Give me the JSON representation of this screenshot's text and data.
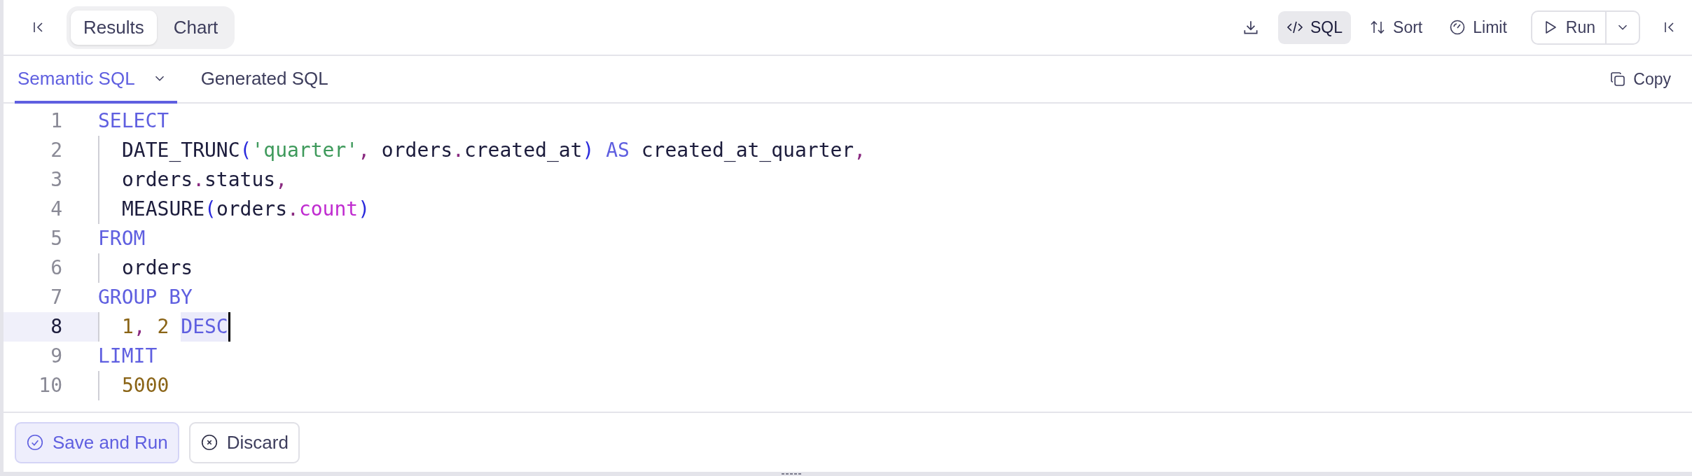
{
  "toolbar": {
    "view_tabs": [
      {
        "label": "Results",
        "selected": true
      },
      {
        "label": "Chart",
        "selected": false
      }
    ],
    "actions": [
      {
        "kind": "download",
        "selected": false
      },
      {
        "kind": "sql",
        "label": "SQL",
        "selected": true
      },
      {
        "kind": "sort",
        "label": "Sort",
        "selected": false
      },
      {
        "kind": "limit",
        "label": "Limit",
        "selected": false
      }
    ],
    "run_button": {
      "label": "Run"
    }
  },
  "editor_tabs": [
    {
      "label": "Semantic SQL",
      "selected": true,
      "has_dropdown": true
    },
    {
      "label": "Generated SQL",
      "selected": false,
      "has_dropdown": false
    }
  ],
  "copy_button": {
    "label": "Copy"
  },
  "code_lines": [
    {
      "number": "1",
      "indented": false,
      "selected": false,
      "tokens": [
        {
          "kind": "keyword",
          "text": "SELECT"
        }
      ]
    },
    {
      "number": "2",
      "indented": true,
      "selected": false,
      "tokens": [
        {
          "kind": "ident",
          "text": "DATE_TRUNC"
        },
        {
          "kind": "paren",
          "text": "("
        },
        {
          "kind": "string",
          "text": "'quarter'"
        },
        {
          "kind": "punct",
          "text": ","
        },
        {
          "kind": "ident",
          "text": " orders"
        },
        {
          "kind": "punct",
          "text": "."
        },
        {
          "kind": "ident",
          "text": "created_at"
        },
        {
          "kind": "paren",
          "text": ")"
        },
        {
          "kind": "keyword",
          "text": " AS "
        },
        {
          "kind": "ident",
          "text": "created_at_quarter"
        },
        {
          "kind": "punct",
          "text": ","
        }
      ]
    },
    {
      "number": "3",
      "indented": true,
      "selected": false,
      "tokens": [
        {
          "kind": "ident",
          "text": "orders"
        },
        {
          "kind": "punct",
          "text": "."
        },
        {
          "kind": "ident",
          "text": "status"
        },
        {
          "kind": "punct",
          "text": ","
        }
      ]
    },
    {
      "number": "4",
      "indented": true,
      "selected": false,
      "tokens": [
        {
          "kind": "ident",
          "text": "MEASURE"
        },
        {
          "kind": "paren",
          "text": "("
        },
        {
          "kind": "ident",
          "text": "orders"
        },
        {
          "kind": "punct",
          "text": "."
        },
        {
          "kind": "property",
          "text": "count"
        },
        {
          "kind": "paren",
          "text": ")"
        }
      ]
    },
    {
      "number": "5",
      "indented": false,
      "selected": false,
      "tokens": [
        {
          "kind": "keyword",
          "text": "FROM"
        }
      ]
    },
    {
      "number": "6",
      "indented": true,
      "selected": false,
      "tokens": [
        {
          "kind": "ident",
          "text": "orders"
        }
      ]
    },
    {
      "number": "7",
      "indented": false,
      "selected": false,
      "tokens": [
        {
          "kind": "keyword",
          "text": "GROUP BY"
        }
      ]
    },
    {
      "number": "8",
      "indented": true,
      "selected": true,
      "tokens": [
        {
          "kind": "number",
          "text": "1"
        },
        {
          "kind": "punct",
          "text": ","
        },
        {
          "kind": "number",
          "text": " 2 "
        },
        {
          "kind": "keyword",
          "text": "DESC",
          "highlighted": true,
          "cursor_after": true
        }
      ]
    },
    {
      "number": "9",
      "indented": false,
      "selected": false,
      "tokens": [
        {
          "kind": "keyword",
          "text": "LIMIT"
        }
      ]
    },
    {
      "number": "10",
      "indented": true,
      "selected": false,
      "tokens": [
        {
          "kind": "number",
          "text": "5000"
        }
      ]
    }
  ],
  "footer_buttons": [
    {
      "kind": "primary",
      "label": "Save and Run"
    },
    {
      "kind": "secondary",
      "label": "Discard"
    }
  ]
}
